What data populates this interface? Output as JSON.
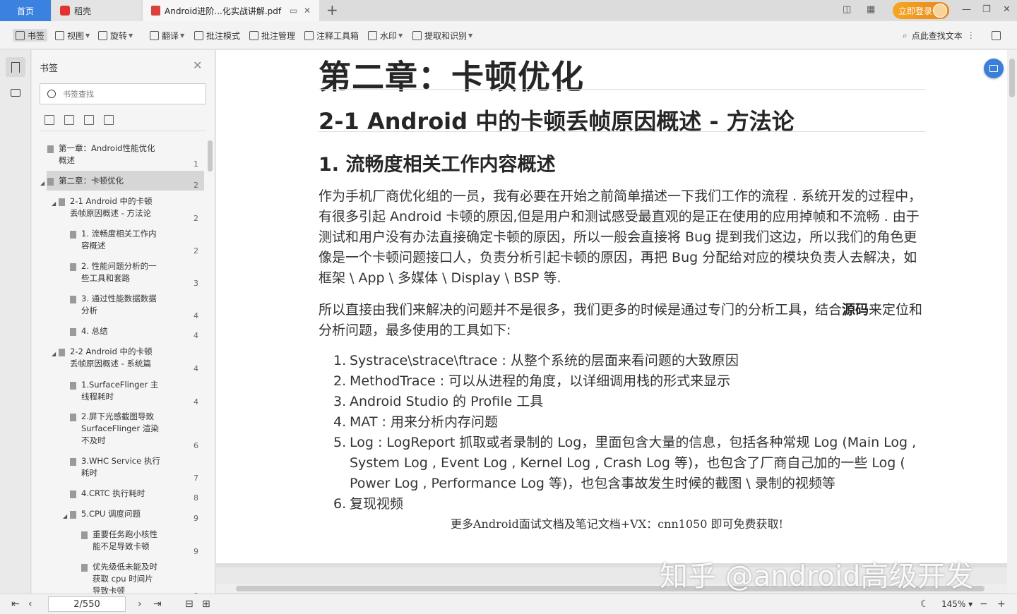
{
  "tabs": {
    "home": "首页",
    "daoke": "稻壳",
    "doc": "Android进阶...化实战讲解.pdf",
    "login": "立即登录"
  },
  "toolbar": {
    "bookmark": "书签",
    "view": "视图",
    "rotate": "旋转",
    "translate": "翻译",
    "annotate_mode": "批注模式",
    "annotate_manage": "批注管理",
    "annotate_tools": "注释工具箱",
    "watermark": "水印",
    "extract": "提取和识别",
    "find_text": "点此查找文本"
  },
  "sidebar": {
    "title": "书签",
    "search_placeholder": "书签查找",
    "items": [
      {
        "text": "第一章：Android性能优化概述",
        "line1": "第一章：Android性能优化",
        "line2": "概述",
        "page": "1"
      },
      {
        "text": "第二章：卡顿优化",
        "page": "2"
      },
      {
        "line1": "2-1 Android 中的卡顿",
        "line2": "丢帧原因概述 - 方法论",
        "page": "2"
      },
      {
        "line1": "1. 流畅度相关工作内",
        "line2": "容概述",
        "page": "2"
      },
      {
        "line1": "2. 性能问题分析的一",
        "line2": "些工具和套路",
        "page": "3"
      },
      {
        "line1": "3. 通过性能数据数据",
        "line2": "分析",
        "page": "4"
      },
      {
        "text": "4. 总结",
        "page": "4"
      },
      {
        "line1": "2-2 Android 中的卡顿",
        "line2": "丢帧原因概述 - 系统篇",
        "page": "4"
      },
      {
        "line1": "1.SurfaceFlinger 主",
        "line2": "线程耗时",
        "page": "4"
      },
      {
        "line1": "2.屏下光感截图导致",
        "line2": "SurfaceFlinger 渲染",
        "line3": "不及时",
        "page": "6"
      },
      {
        "line1": "3.WHC Service 执行",
        "line2": "耗时",
        "page": "7"
      },
      {
        "text": "4.CRTC 执行耗时",
        "page": "8"
      },
      {
        "text": "5.CPU 调度问题",
        "page": "9"
      },
      {
        "line1": "重要任务跑小核性",
        "line2": "能不足导致卡顿",
        "page": "9"
      },
      {
        "line1": "优先级低未能及时",
        "line2": "获取 cpu 时间片",
        "line3": "导致卡顿",
        "page": "9"
      }
    ]
  },
  "document": {
    "h1": "第二章：卡顿优化",
    "h2": "2-1 Android 中的卡顿丢帧原因概述 - 方法论",
    "h3": "1. 流畅度相关工作内容概述",
    "para1": "作为手机厂商优化组的一员，我有必要在开始之前简单描述一下我们工作的流程 . 系统开发的过程中，有很多引起 Android 卡顿的原因,但是用户和测试感受最直观的是正在使用的应用掉帧和不流畅 . 由于测试和用户没有办法直接确定卡顿的原因，所以一般会直接将 Bug 提到我们这边，所以我们的角色更像是一个卡顿问题接口人，负责分析引起卡顿的原因，再把 Bug 分配给对应的模块负责人去解决，如框架 \\ App \\ 多媒体 \\ Display \\ BSP 等.",
    "para2_pre": "所以直接由我们来解决的问题并不是很多，我们更多的时候是通过专门的分析工具，结合",
    "para2_bold": "源码",
    "para2_post": "来定位和分析问题，最多使用的工具如下:",
    "list": [
      {
        "num": "1.",
        "text": "Systrace\\strace\\ftrace : 从整个系统的层面来看问题的大致原因"
      },
      {
        "num": "2.",
        "text": "MethodTrace : 可以从进程的角度，以详细调用栈的形式来显示"
      },
      {
        "num": "3.",
        "text": "Android Studio 的 Profile 工具"
      },
      {
        "num": "4.",
        "text": "MAT : 用来分析内存问题"
      },
      {
        "num": "5.",
        "text": "Log : LogReport 抓取或者录制的 Log，里面包含大量的信息，包括各种常规 Log (Main Log , System Log , Event Log , Kernel Log , Crash Log 等)，也包含了厂商自己加的一些 Log ( Power Log , Performance Log 等)，也包含事故发生时候的截图 \\ 录制的视频等"
      },
      {
        "num": "6.",
        "text": "复现视频"
      }
    ],
    "footer_note": "更多Android面试文档及笔记文档+VX：cnn1050 即可免费获取!",
    "watermark": "知乎 @android高级开发"
  },
  "status": {
    "page_indicator": "2/550",
    "zoom": "145%"
  },
  "colors": {
    "accent": "#3b82e0",
    "login": "#f0a020",
    "selected_bookmark": "#d6d6d6"
  }
}
